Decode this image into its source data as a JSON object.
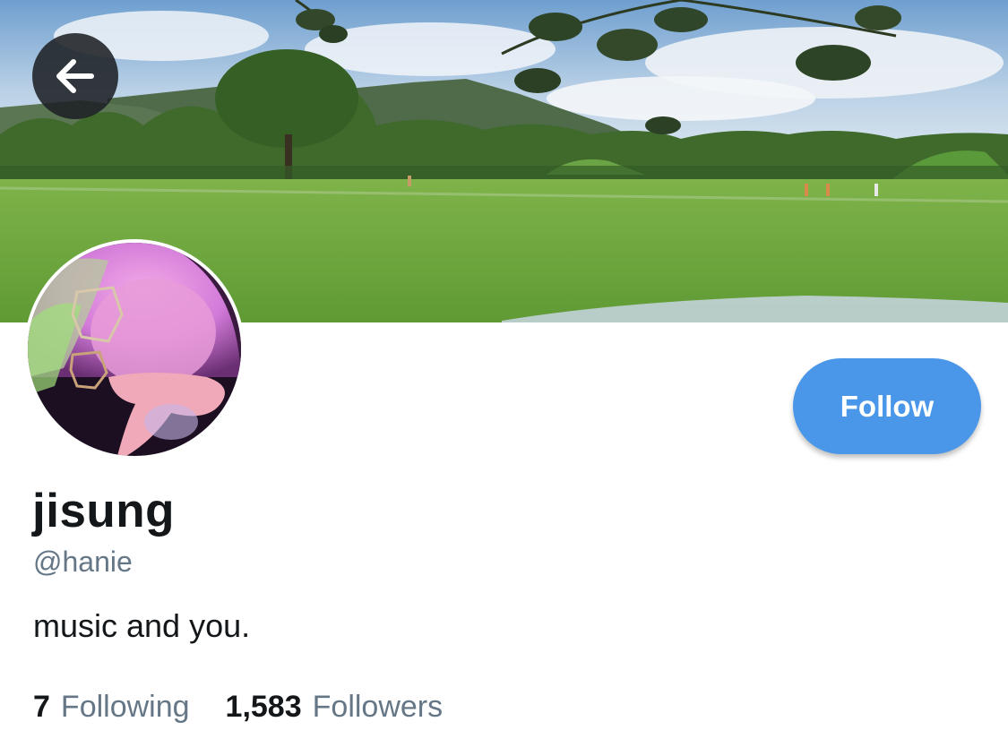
{
  "header": {
    "back_icon": "arrow-left-icon",
    "banner_image": "park-landscape"
  },
  "profile": {
    "avatar_image": "profile-photo",
    "display_name": "jisung",
    "handle": "@hanie",
    "bio": "music and you."
  },
  "actions": {
    "follow_label": "Follow"
  },
  "stats": {
    "following_count": "7",
    "following_label": "Following",
    "followers_count": "1,583",
    "followers_label": "Followers"
  },
  "colors": {
    "accent": "#4a97ea",
    "text_primary": "#14171a",
    "text_secondary": "#657786"
  }
}
